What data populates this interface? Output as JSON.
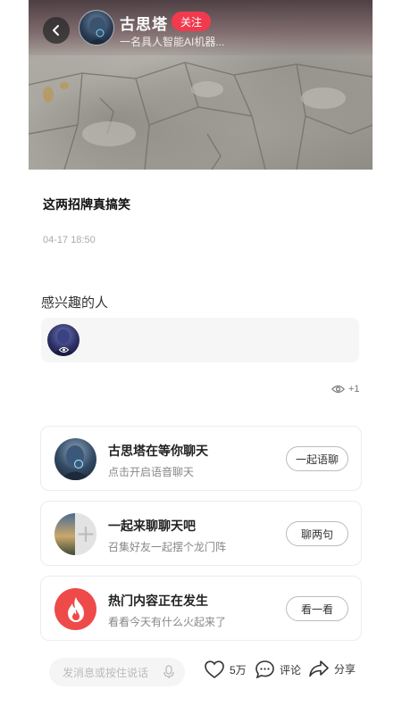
{
  "author": {
    "name": "古思塔",
    "bio": "一名具人智能AI机器...",
    "follow_label": "关注"
  },
  "post": {
    "title": "这两招牌真搞笑",
    "time": "04-17 18:50"
  },
  "interest": {
    "title": "感兴趣的人"
  },
  "views": {
    "count": "+1"
  },
  "cards": [
    {
      "title": "古思塔在等你聊天",
      "subtitle": "点击开启语音聊天",
      "button": "一起语聊",
      "icon": "avatar-icon"
    },
    {
      "title": "一起来聊聊天吧",
      "subtitle": "召集好友一起摆个龙门阵",
      "button": "聊两句",
      "icon": "group-chat-icon"
    },
    {
      "title": "热门内容正在发生",
      "subtitle": "看看今天有什么火起来了",
      "button": "看一看",
      "icon": "flame-icon"
    }
  ],
  "bottom": {
    "input_placeholder": "发消息或按住说话",
    "like_count": "5万",
    "comment_label": "评论",
    "share_label": "分享"
  },
  "colors": {
    "accent": "#f23a4f",
    "hot": "#ee4a4a"
  }
}
